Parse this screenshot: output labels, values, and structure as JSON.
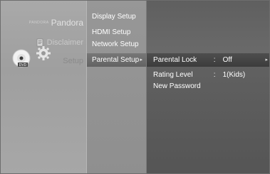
{
  "left_menu": {
    "pandora_prefix": "PANDORA",
    "pandora": "Pandora",
    "disclaimer": "Disclaimer",
    "setup": "Setup"
  },
  "middle_menu": [
    {
      "label": "Display Setup"
    },
    {
      "label": "HDMI Setup"
    },
    {
      "label": "Network Setup"
    },
    {
      "label": "Parental Setup",
      "arrow": "▸"
    }
  ],
  "parental_menu": {
    "items": [
      {
        "label": "Parental Lock",
        "sep": ":",
        "value": "Off",
        "arrow": "▸"
      },
      {
        "label": "Rating Level",
        "sep": ":",
        "value": "1(Kids)"
      },
      {
        "label": "New Password",
        "sep": "",
        "value": ""
      }
    ]
  },
  "icons": [
    "dvd-disc-icon",
    "gear-icon",
    "disclaimer-icon"
  ]
}
